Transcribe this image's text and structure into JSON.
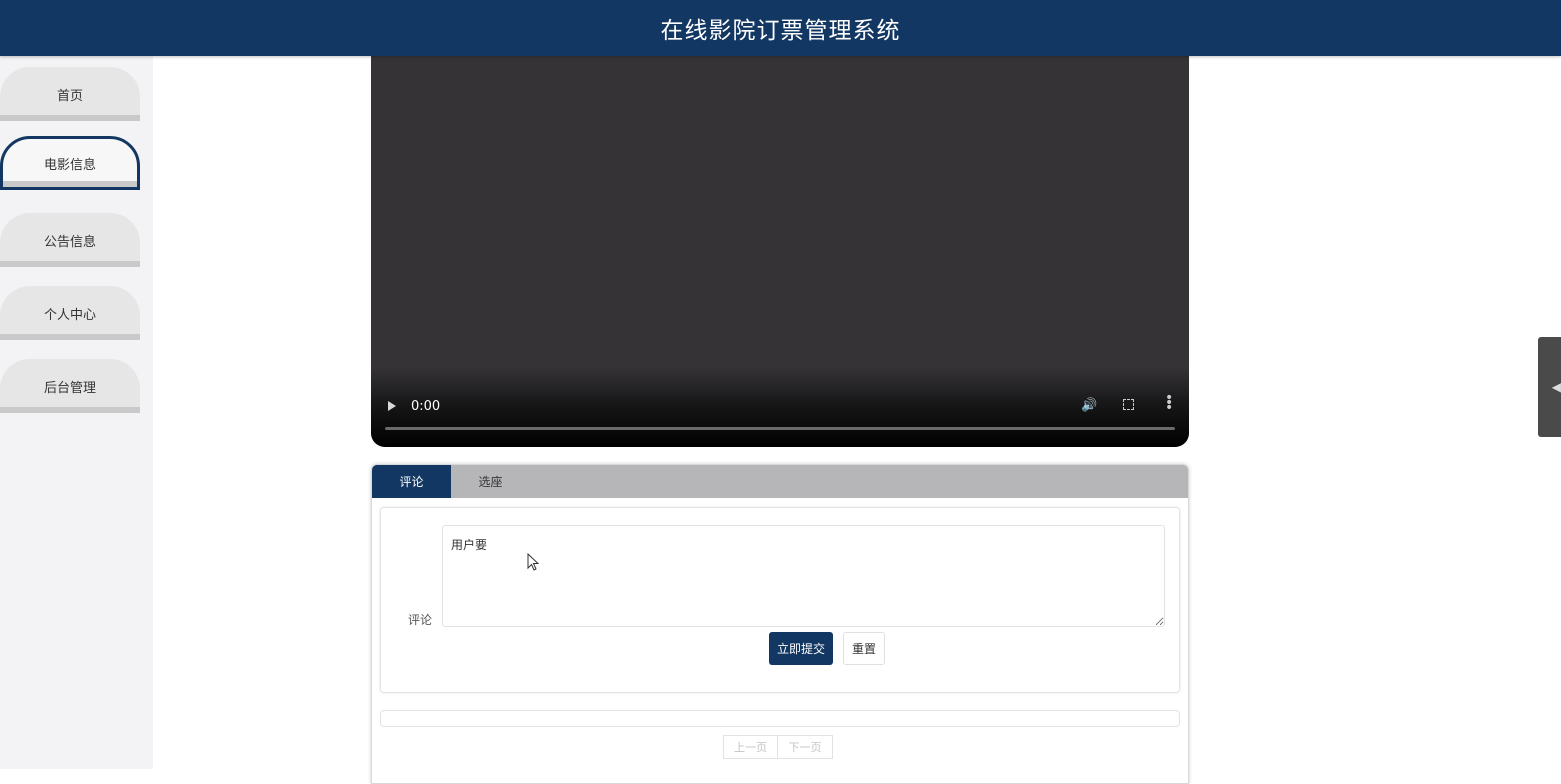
{
  "header": {
    "title": "在线影院订票管理系统"
  },
  "sidebar": {
    "items": [
      {
        "label": "首页",
        "active": false
      },
      {
        "label": "电影信息",
        "active": true
      },
      {
        "label": "公告信息",
        "active": false
      },
      {
        "label": "个人中心",
        "active": false
      },
      {
        "label": "后台管理",
        "active": false
      }
    ]
  },
  "video": {
    "time": "0:00",
    "icons": [
      "play-icon",
      "volume-icon",
      "fullscreen-icon",
      "more-vertical-icon"
    ]
  },
  "tabs": [
    {
      "label": "评论",
      "active": true
    },
    {
      "label": "选座",
      "active": false
    }
  ],
  "comment_form": {
    "label": "评论",
    "textarea_value": "用户要",
    "submit_label": "立即提交",
    "reset_label": "重置"
  },
  "pagination": {
    "prev_label": "上一页",
    "next_label": "下一页"
  },
  "colors": {
    "primary": "#123762",
    "tab_bar": "#b6b5b8",
    "video_bg": "#353336"
  }
}
